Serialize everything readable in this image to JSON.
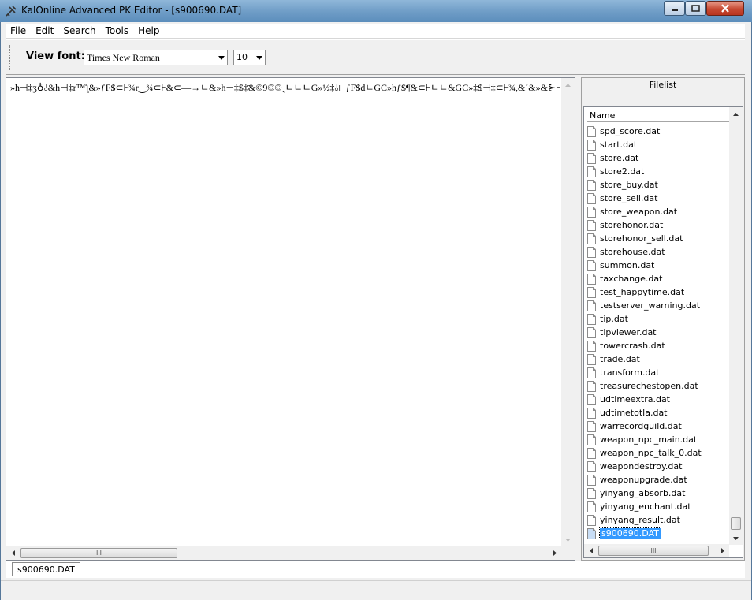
{
  "window": {
    "title": "KalOnline Advanced PK Editor - [s900690.DAT]"
  },
  "menu": [
    "File",
    "Edit",
    "Search",
    "Tools",
    "Help"
  ],
  "toolbar": {
    "view_font_label": "View font:",
    "font_value": "Times New Roman",
    "size_value": "10"
  },
  "editor": {
    "content": "»h⊣‡ʒ♁⫰&h⊣‡r™ƪ&»ƒF$⊂⊦¾r‿¾⊂⊦&⊂—→ㄴ&»h⊣‡$‡̄&©9©©ˏㄴㄴㄴG»½‡⫰⊢ƒF$dㄴGC»hƒ$¶&⊂⊦ㄴㄴ&GC»‡$⊣‡⊂⊦¾,&ˊ&»&⊱⊦"
  },
  "filelist": {
    "title": "Filelist",
    "column_name": "Name",
    "items": [
      "spd_score.dat",
      "start.dat",
      "store.dat",
      "store2.dat",
      "store_buy.dat",
      "store_sell.dat",
      "store_weapon.dat",
      "storehonor.dat",
      "storehonor_sell.dat",
      "storehouse.dat",
      "summon.dat",
      "taxchange.dat",
      "test_happytime.dat",
      "testserver_warning.dat",
      "tip.dat",
      "tipviewer.dat",
      "towercrash.dat",
      "trade.dat",
      "transform.dat",
      "treasurechestopen.dat",
      "udtimeextra.dat",
      "udtimetotla.dat",
      "warrecordguild.dat",
      "weapon_npc_main.dat",
      "weapon_npc_talk_0.dat",
      "weapondestroy.dat",
      "weaponupgrade.dat",
      "yinyang_absorb.dat",
      "yinyang_enchant.dat",
      "yinyang_result.dat",
      "s900690.DAT"
    ],
    "selected": "s900690.DAT"
  },
  "tabs": [
    "s900690.DAT"
  ],
  "scrollbar": {
    "grip": "III"
  },
  "colors": {
    "selection": "#3399ff",
    "titlebar": "#6e9cc6",
    "close_button": "#c74a33"
  }
}
